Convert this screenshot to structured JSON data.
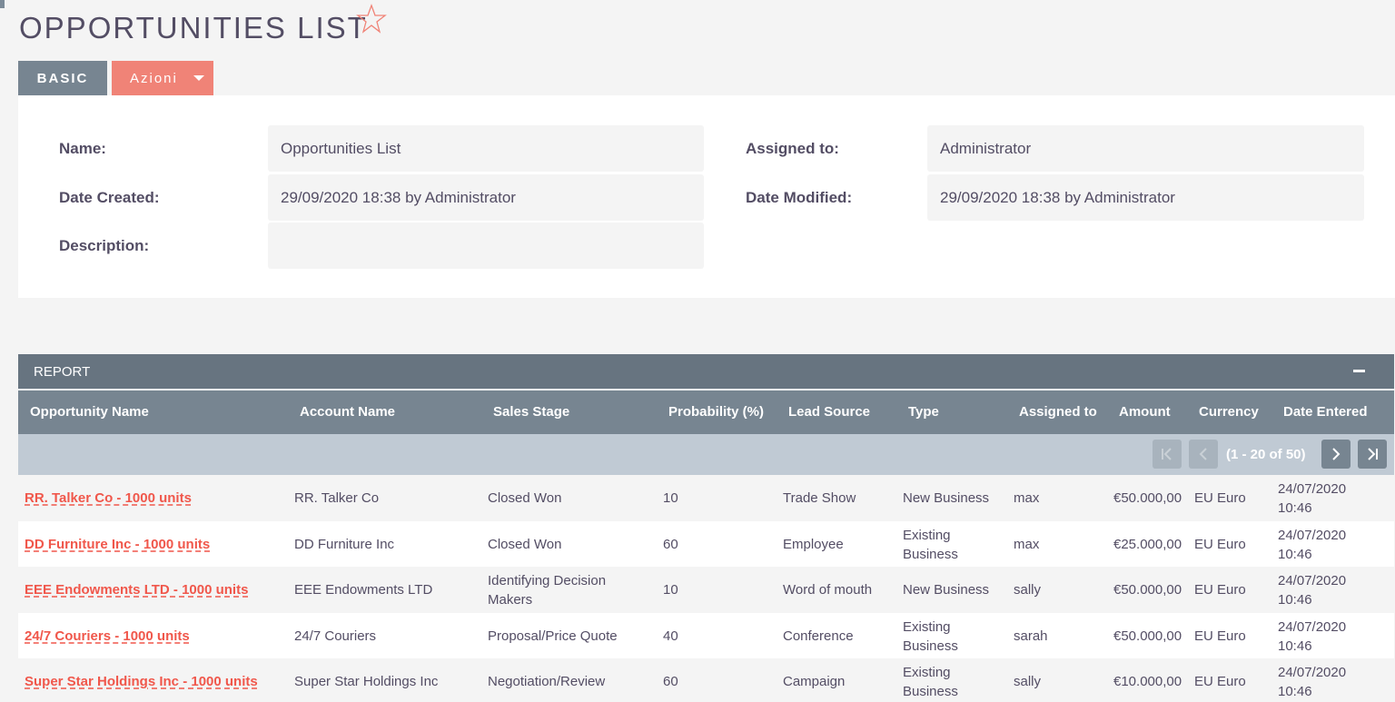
{
  "page": {
    "title": "OPPORTUNITIES LIST"
  },
  "tabs": {
    "basic": "BASIC",
    "actions": "Azioni"
  },
  "details": {
    "name_label": "Name:",
    "name_value": "Opportunities List",
    "assigned_label": "Assigned to:",
    "assigned_value": "Administrator",
    "created_label": "Date Created:",
    "created_value": "29/09/2020 18:38 by Administrator",
    "modified_label": "Date Modified:",
    "modified_value": "29/09/2020 18:38 by Administrator",
    "description_label": "Description:",
    "description_value": ""
  },
  "report": {
    "title": "REPORT",
    "columns": [
      "Opportunity Name",
      "Account Name",
      "Sales Stage",
      "Probability (%)",
      "Lead Source",
      "Type",
      "Assigned to",
      "Amount",
      "Currency",
      "Date Entered"
    ],
    "pager_text": "(1 - 20 of 50)",
    "rows": [
      {
        "opportunity": "RR. Talker Co - 1000 units",
        "account": "RR. Talker Co",
        "stage": "Closed Won",
        "probability": "10",
        "lead_source": "Trade Show",
        "type": "New Business",
        "assigned": "max",
        "amount": "€50.000,00",
        "currency": "EU Euro",
        "date_entered": "24/07/2020 10:46"
      },
      {
        "opportunity": "DD Furniture Inc - 1000 units",
        "account": "DD Furniture Inc",
        "stage": "Closed Won",
        "probability": "60",
        "lead_source": "Employee",
        "type": "Existing Business",
        "assigned": "max",
        "amount": "€25.000,00",
        "currency": "EU Euro",
        "date_entered": "24/07/2020 10:46"
      },
      {
        "opportunity": "EEE Endowments LTD - 1000 units",
        "account": "EEE Endowments LTD",
        "stage": "Identifying Decision Makers",
        "probability": "10",
        "lead_source": "Word of mouth",
        "type": "New Business",
        "assigned": "sally",
        "amount": "€50.000,00",
        "currency": "EU Euro",
        "date_entered": "24/07/2020 10:46"
      },
      {
        "opportunity": "24/7 Couriers - 1000 units",
        "account": "24/7 Couriers",
        "stage": "Proposal/Price Quote",
        "probability": "40",
        "lead_source": "Conference",
        "type": "Existing Business",
        "assigned": "sarah",
        "amount": "€50.000,00",
        "currency": "EU Euro",
        "date_entered": "24/07/2020 10:46"
      },
      {
        "opportunity": "Super Star Holdings Inc - 1000 units",
        "account": "Super Star Holdings Inc",
        "stage": "Negotiation/Review",
        "probability": "60",
        "lead_source": "Campaign",
        "type": "Existing Business",
        "assigned": "sally",
        "amount": "€10.000,00",
        "currency": "EU Euro",
        "date_entered": "24/07/2020 10:46"
      }
    ]
  },
  "colors": {
    "accent": "#f08377",
    "link": "#f0574b",
    "header": "#677480",
    "subheader": "#778591"
  }
}
